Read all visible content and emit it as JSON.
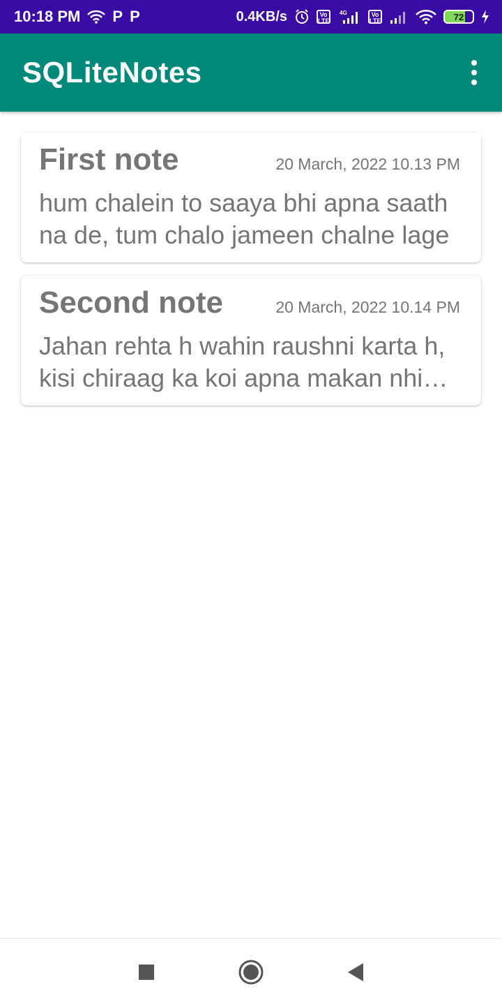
{
  "status_bar": {
    "time": "10:18 PM",
    "net_speed": "0.4KB/s",
    "notif_p1": "P",
    "notif_p2": "P",
    "volte1": "Vo LTE",
    "network": "4G",
    "volte2": "Vo LTE",
    "battery": "72",
    "icons": [
      "wifi-icon",
      "alarm-icon",
      "signal-icon",
      "charging-icon"
    ]
  },
  "app_bar": {
    "title": "SQLiteNotes",
    "menu_icon": "overflow-menu-icon"
  },
  "notes": [
    {
      "title": "First note",
      "date": "20 March, 2022 10.13 PM",
      "body": "hum chalein to saaya bhi apna saath na de, tum chalo jameen chalne lage"
    },
    {
      "title": "Second note",
      "date": "20 March, 2022 10.14 PM",
      "body": "Jahan rehta h wahin raushni karta h, kisi chiraag ka koi apna makan nhi hota"
    }
  ],
  "nav_bar": {
    "icons": [
      "recents-icon",
      "home-icon",
      "back-icon"
    ]
  },
  "colors": {
    "status_bar": "#3a0ca3",
    "app_bar": "#00897b",
    "text_muted": "#757575"
  }
}
